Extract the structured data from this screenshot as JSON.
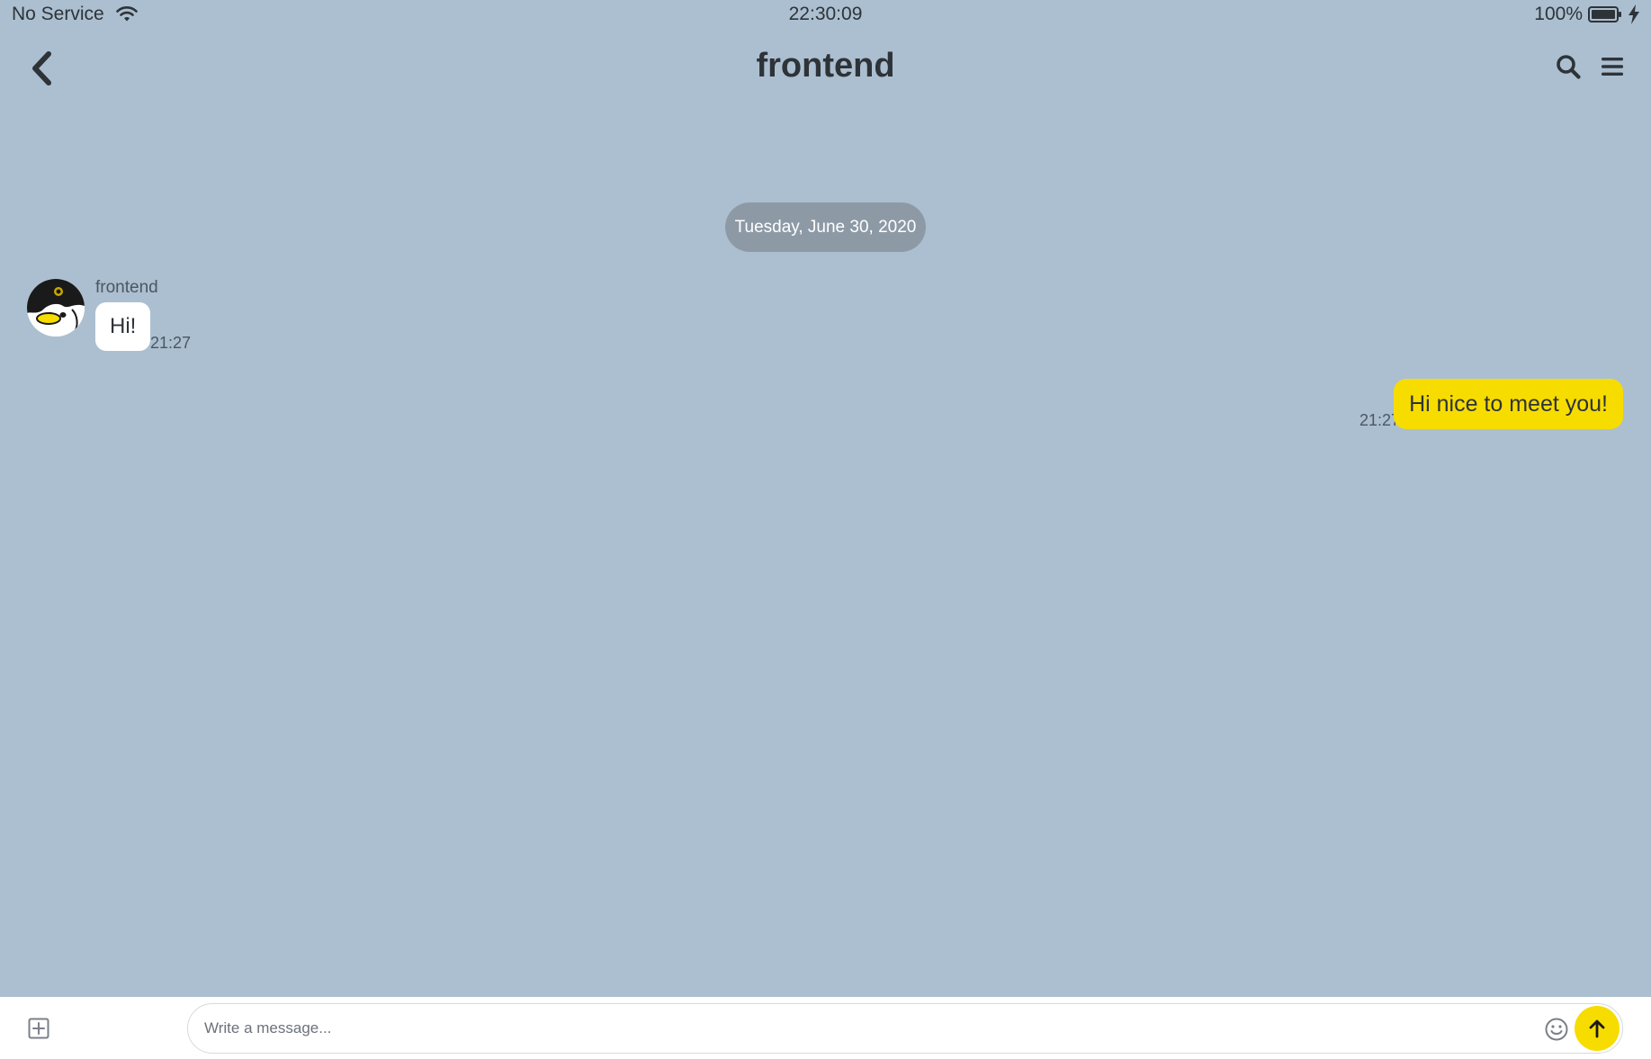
{
  "status_bar": {
    "carrier": "No Service",
    "time": "22:30:09",
    "battery": "100%"
  },
  "header": {
    "title": "frontend",
    "icons": {
      "back": "chevron-left-icon",
      "search": "search-icon",
      "menu": "hamburger-menu-icon"
    }
  },
  "conversation": {
    "date_label": "Tuesday, June 30, 2020",
    "messages": [
      {
        "direction": "incoming",
        "sender": "frontend",
        "text": "Hi!",
        "time": "21:27"
      },
      {
        "direction": "outgoing",
        "text": "Hi nice to meet you!",
        "time": "21:27"
      }
    ]
  },
  "composer": {
    "placeholder": "Write a message...",
    "value": "",
    "icons": {
      "attach": "plus-square-icon",
      "emoji": "smiley-icon",
      "send": "arrow-up-icon"
    }
  },
  "colors": {
    "background": "#abbfd0",
    "accent_yellow": "#f7dc00",
    "date_pill": "#8d9aa6",
    "text_dark": "#2e3338"
  }
}
